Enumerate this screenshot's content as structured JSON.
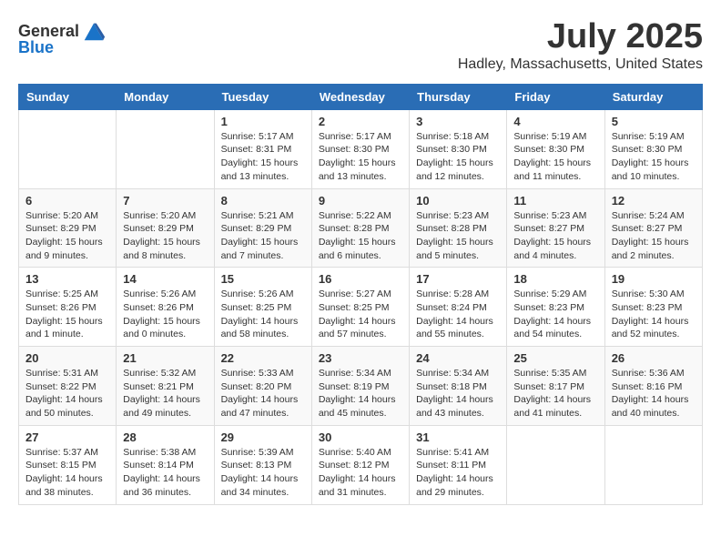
{
  "logo": {
    "general": "General",
    "blue": "Blue"
  },
  "header": {
    "month": "July 2025",
    "location": "Hadley, Massachusetts, United States"
  },
  "weekdays": [
    "Sunday",
    "Monday",
    "Tuesday",
    "Wednesday",
    "Thursday",
    "Friday",
    "Saturday"
  ],
  "weeks": [
    [
      {
        "day": "",
        "info": ""
      },
      {
        "day": "",
        "info": ""
      },
      {
        "day": "1",
        "info": "Sunrise: 5:17 AM\nSunset: 8:31 PM\nDaylight: 15 hours and 13 minutes."
      },
      {
        "day": "2",
        "info": "Sunrise: 5:17 AM\nSunset: 8:30 PM\nDaylight: 15 hours and 13 minutes."
      },
      {
        "day": "3",
        "info": "Sunrise: 5:18 AM\nSunset: 8:30 PM\nDaylight: 15 hours and 12 minutes."
      },
      {
        "day": "4",
        "info": "Sunrise: 5:19 AM\nSunset: 8:30 PM\nDaylight: 15 hours and 11 minutes."
      },
      {
        "day": "5",
        "info": "Sunrise: 5:19 AM\nSunset: 8:30 PM\nDaylight: 15 hours and 10 minutes."
      }
    ],
    [
      {
        "day": "6",
        "info": "Sunrise: 5:20 AM\nSunset: 8:29 PM\nDaylight: 15 hours and 9 minutes."
      },
      {
        "day": "7",
        "info": "Sunrise: 5:20 AM\nSunset: 8:29 PM\nDaylight: 15 hours and 8 minutes."
      },
      {
        "day": "8",
        "info": "Sunrise: 5:21 AM\nSunset: 8:29 PM\nDaylight: 15 hours and 7 minutes."
      },
      {
        "day": "9",
        "info": "Sunrise: 5:22 AM\nSunset: 8:28 PM\nDaylight: 15 hours and 6 minutes."
      },
      {
        "day": "10",
        "info": "Sunrise: 5:23 AM\nSunset: 8:28 PM\nDaylight: 15 hours and 5 minutes."
      },
      {
        "day": "11",
        "info": "Sunrise: 5:23 AM\nSunset: 8:27 PM\nDaylight: 15 hours and 4 minutes."
      },
      {
        "day": "12",
        "info": "Sunrise: 5:24 AM\nSunset: 8:27 PM\nDaylight: 15 hours and 2 minutes."
      }
    ],
    [
      {
        "day": "13",
        "info": "Sunrise: 5:25 AM\nSunset: 8:26 PM\nDaylight: 15 hours and 1 minute."
      },
      {
        "day": "14",
        "info": "Sunrise: 5:26 AM\nSunset: 8:26 PM\nDaylight: 15 hours and 0 minutes."
      },
      {
        "day": "15",
        "info": "Sunrise: 5:26 AM\nSunset: 8:25 PM\nDaylight: 14 hours and 58 minutes."
      },
      {
        "day": "16",
        "info": "Sunrise: 5:27 AM\nSunset: 8:25 PM\nDaylight: 14 hours and 57 minutes."
      },
      {
        "day": "17",
        "info": "Sunrise: 5:28 AM\nSunset: 8:24 PM\nDaylight: 14 hours and 55 minutes."
      },
      {
        "day": "18",
        "info": "Sunrise: 5:29 AM\nSunset: 8:23 PM\nDaylight: 14 hours and 54 minutes."
      },
      {
        "day": "19",
        "info": "Sunrise: 5:30 AM\nSunset: 8:23 PM\nDaylight: 14 hours and 52 minutes."
      }
    ],
    [
      {
        "day": "20",
        "info": "Sunrise: 5:31 AM\nSunset: 8:22 PM\nDaylight: 14 hours and 50 minutes."
      },
      {
        "day": "21",
        "info": "Sunrise: 5:32 AM\nSunset: 8:21 PM\nDaylight: 14 hours and 49 minutes."
      },
      {
        "day": "22",
        "info": "Sunrise: 5:33 AM\nSunset: 8:20 PM\nDaylight: 14 hours and 47 minutes."
      },
      {
        "day": "23",
        "info": "Sunrise: 5:34 AM\nSunset: 8:19 PM\nDaylight: 14 hours and 45 minutes."
      },
      {
        "day": "24",
        "info": "Sunrise: 5:34 AM\nSunset: 8:18 PM\nDaylight: 14 hours and 43 minutes."
      },
      {
        "day": "25",
        "info": "Sunrise: 5:35 AM\nSunset: 8:17 PM\nDaylight: 14 hours and 41 minutes."
      },
      {
        "day": "26",
        "info": "Sunrise: 5:36 AM\nSunset: 8:16 PM\nDaylight: 14 hours and 40 minutes."
      }
    ],
    [
      {
        "day": "27",
        "info": "Sunrise: 5:37 AM\nSunset: 8:15 PM\nDaylight: 14 hours and 38 minutes."
      },
      {
        "day": "28",
        "info": "Sunrise: 5:38 AM\nSunset: 8:14 PM\nDaylight: 14 hours and 36 minutes."
      },
      {
        "day": "29",
        "info": "Sunrise: 5:39 AM\nSunset: 8:13 PM\nDaylight: 14 hours and 34 minutes."
      },
      {
        "day": "30",
        "info": "Sunrise: 5:40 AM\nSunset: 8:12 PM\nDaylight: 14 hours and 31 minutes."
      },
      {
        "day": "31",
        "info": "Sunrise: 5:41 AM\nSunset: 8:11 PM\nDaylight: 14 hours and 29 minutes."
      },
      {
        "day": "",
        "info": ""
      },
      {
        "day": "",
        "info": ""
      }
    ]
  ]
}
